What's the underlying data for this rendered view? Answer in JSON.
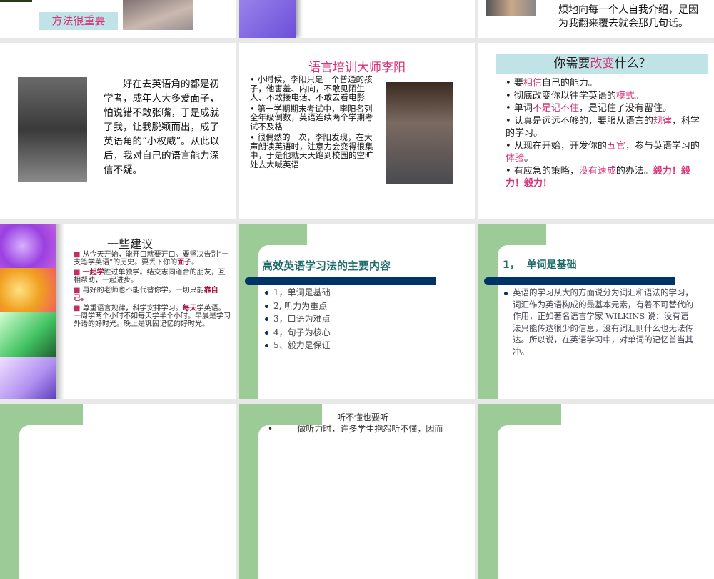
{
  "slides": [
    {
      "title_box": "方法很重要"
    },
    {},
    {
      "lines": [
        "烦地向每一个人自我介绍，是因",
        "为我翻来覆去就会那几句话。"
      ]
    },
    {
      "paragraph": "好在去英语角的都是初学者，成年人大多爱面子，怕说错不敢张嘴，于是成就了我，让我脱颖而出，成了英语角的“小权威”。从此以后，我对自己的语言能力深信不疑。"
    },
    {
      "title": "语言培训大师李阳",
      "bullets": [
        "小时候，李阳只是一个普通的孩子，他害羞、内向，不敢见陌生人、不敢接电话、不敢去看电影",
        "第一学期期末考试中，李阳名列全年级倒数，英语连续两个学期考试不及格",
        "很偶然的一次，李阳发现，在大声朗读英语时，注意力会变得很集中，于是他就天天跑到校园的空旷处去大喊英语"
      ]
    },
    {
      "title_a": "你需要",
      "title_b": "改变",
      "title_c": "什么？",
      "b1": [
        "要",
        "相信",
        "自己的能力。"
      ],
      "b2": [
        "彻底改变你以往学英语的",
        "模式",
        "。"
      ],
      "b3": [
        "单词",
        "不是记不住",
        "，是记住了没有留住。"
      ],
      "b4": [
        "认真是远远不够的，要服从语言的",
        "规律",
        "，科学的学习。"
      ],
      "b5": [
        "从现在开始，开发你的",
        "五官",
        "，参与英语学习的",
        "体验",
        "。"
      ],
      "b6": [
        "有应急的策略，",
        "没有速成",
        "的办法。",
        "毅力！毅力！毅力！"
      ]
    },
    {
      "title": "一些建议",
      "b1": [
        "从今天开始，能开口就要开口。要坚决告别“一支笔学英语”的历史。要丢下你的",
        "面子",
        "。"
      ],
      "b2": [
        "一起学",
        "胜过单独学。结交志同道合的朋友，互相帮助，一起进步。"
      ],
      "b3": [
        "再好的老师也不能代替你学。一切只能",
        "靠自己。"
      ],
      "b4": [
        "尊重语言规律，科学安排学习。",
        "每天",
        "学英语。一周学两个小时不如每天学半个小时。早晨是学习外语的好时光。晚上是巩固记忆的好时光。"
      ]
    },
    {
      "title": "高效英语学习法的主要内容",
      "items": [
        "1，单词是基础",
        "2, 听力为重点",
        "3，口语为难点",
        "4，句子为核心",
        "5、毅力是保证"
      ]
    },
    {
      "title": "1，  单词是基础",
      "body": "英语的学习从大的方面说分为词汇和语法的学习，词汇作为英语构成的最基本元素，有着不可替代的作用，正如著名语言学家 WILKINS 说：没有语法只能传达很少的信息，没有词汇则什么也无法传达。所以说，在英语学习中，对单词的记忆首当其冲。"
    },
    {},
    {
      "title": "听不懂也要听",
      "partial": "做听力时，许多学生抱怨听不懂，因而"
    },
    {}
  ]
}
